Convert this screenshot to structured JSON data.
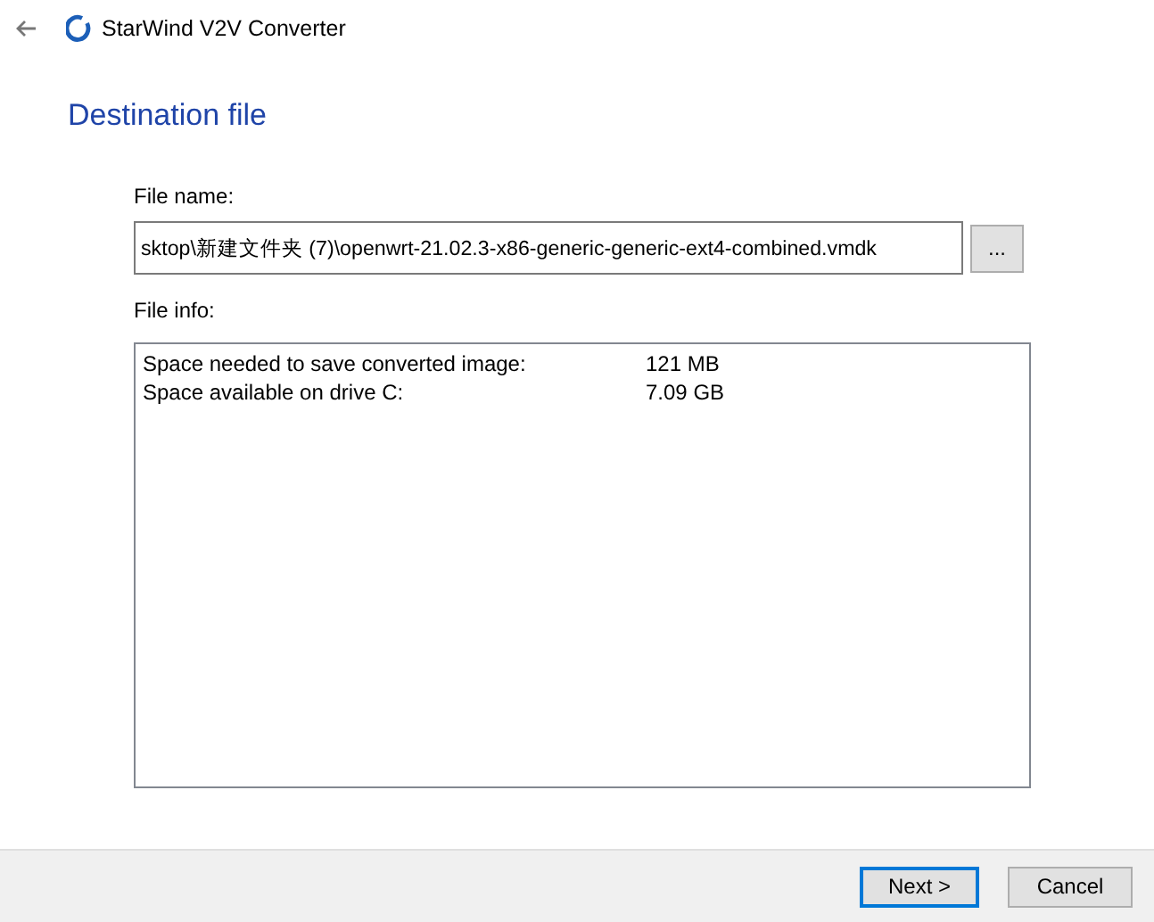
{
  "window": {
    "title": "StarWind V2V Converter"
  },
  "heading": "Destination file",
  "file_name": {
    "label": "File name:",
    "value": "sktop\\新建文件夹 (7)\\openwrt-21.02.3-x86-generic-generic-ext4-combined.vmdk",
    "browse": "..."
  },
  "file_info": {
    "label": "File info:",
    "rows": [
      {
        "label": "Space needed to save converted image:",
        "value": "121 MB"
      },
      {
        "label": "Space available on drive C:",
        "value": "7.09 GB"
      }
    ]
  },
  "buttons": [
    {
      "label": "Next >",
      "focused": true
    },
    {
      "label": "Cancel",
      "focused": false
    }
  ]
}
